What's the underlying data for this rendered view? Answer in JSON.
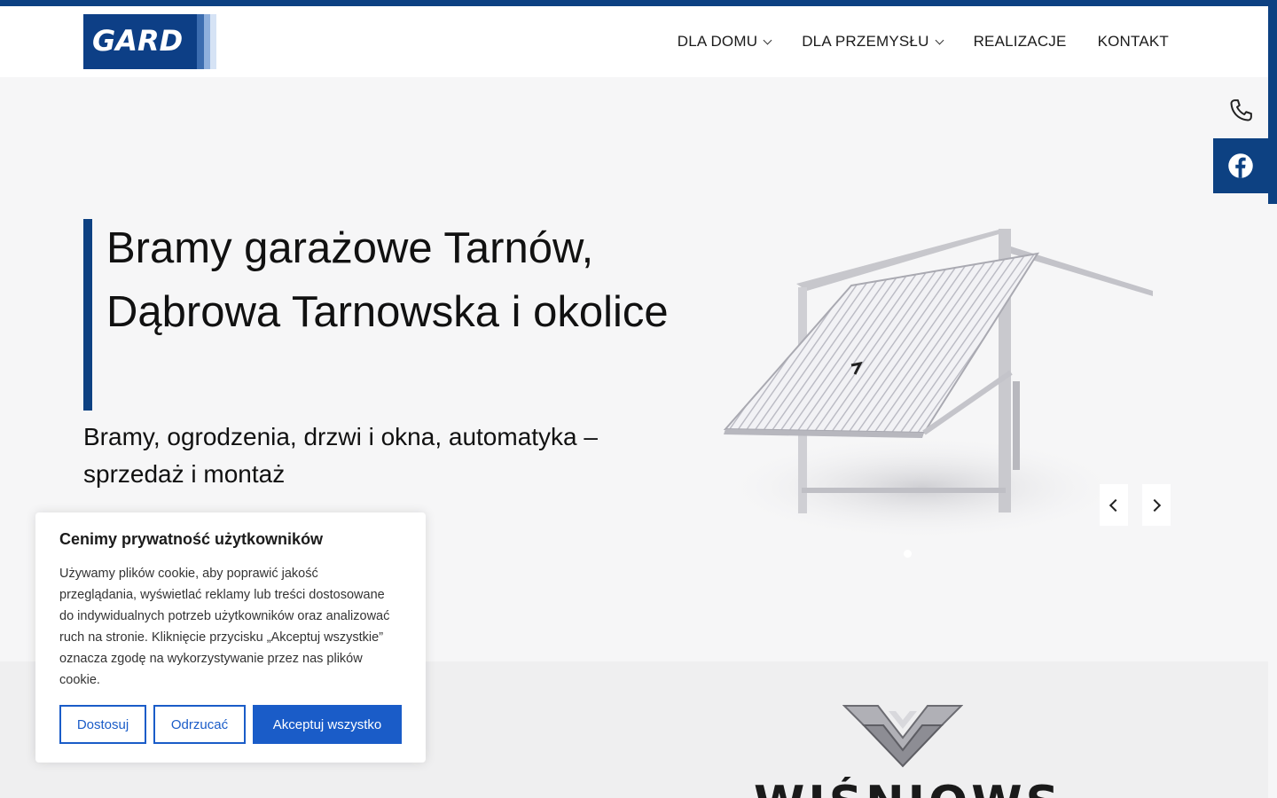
{
  "colors": {
    "brand": "#0d4182",
    "accent_button": "#1a5cc8",
    "hero_bg": "#f6f6f7"
  },
  "header": {
    "logo_text": "GARD",
    "nav": [
      {
        "label": "DLA DOMU",
        "has_dropdown": true
      },
      {
        "label": "DLA PRZEMYSŁU",
        "has_dropdown": true
      },
      {
        "label": "REALIZACJE",
        "has_dropdown": false
      },
      {
        "label": "KONTAKT",
        "has_dropdown": false
      }
    ]
  },
  "hero": {
    "title": "Bramy garażowe Tarnów, Dąbrowa Tarnowska i okolice",
    "subtitle": "Bramy, ogrodzenia, drzwi i okna, automatyka – sprzedaż i montaż",
    "image": "garage-door-image",
    "prev_icon": "chevron-left-icon",
    "next_icon": "chevron-right-icon"
  },
  "side_widgets": {
    "phone_icon": "phone-icon",
    "facebook_icon": "facebook-icon"
  },
  "brand_logo": {
    "text": "WIŚNIOWSKI"
  },
  "cookie": {
    "title": "Cenimy prywatność użytkowników",
    "body": "Używamy plików cookie, aby poprawić jakość przeglądania, wyświetlać reklamy lub treści dostosowane do indywidualnych potrzeb użytkowników oraz analizować ruch na stronie. Kliknięcie przycisku „Akceptuj wszystkie” oznacza zgodę na wykorzystywanie przez nas plików cookie.",
    "customize_label": "Dostosuj",
    "reject_label": "Odrzucać",
    "accept_label": "Akceptuj wszystko"
  }
}
